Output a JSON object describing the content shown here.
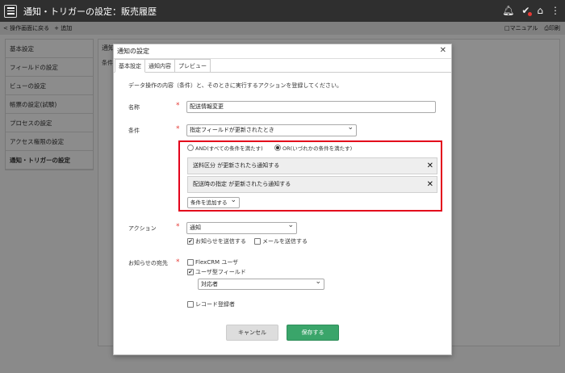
{
  "header": {
    "title": "通知・トリガーの設定：販売履歴",
    "icons": [
      "menu-icon",
      "bell-icon",
      "check-icon",
      "home-icon",
      "more-vert-icon"
    ]
  },
  "toolbar": {
    "back_label": "操作画面に戻る",
    "add_label": "追加",
    "manual_label": "マニュアル",
    "print_label": "印刷"
  },
  "sidebar": {
    "items": [
      {
        "label": "基本設定"
      },
      {
        "label": "フィールドの設定"
      },
      {
        "label": "ビューの設定"
      },
      {
        "label": "帳票の設定(試験)"
      },
      {
        "label": "プロセスの設定"
      },
      {
        "label": "アクセス権限の設定"
      },
      {
        "label": "通知・トリガーの設定"
      }
    ]
  },
  "main": {
    "ghost_title": "通知",
    "ghost_label": "条件"
  },
  "dialog": {
    "title": "通知の設定",
    "tabs": [
      {
        "label": "基本設定"
      },
      {
        "label": "通知内容"
      },
      {
        "label": "プレビュー"
      }
    ],
    "description": "データ操作の内容（条件）と、そのときに実行するアクションを登録してください。",
    "name_label": "名称",
    "name_value": "配送情報変更",
    "condition_label": "条件",
    "condition_value": "指定フィールドが更新されたとき",
    "match_and": "AND(すべての条件を満たす)",
    "match_or": "OR(いづれかの条件を満たす)",
    "conditions": [
      {
        "text": "送料区分 が更新されたら通知する"
      },
      {
        "text": "配送時の指定 が更新されたら通知する"
      }
    ],
    "add_condition": "条件を追加する",
    "action_label": "アクション",
    "action_value": "通知",
    "send_notice": "お知らせを送信する",
    "send_mail": "メールを送信する",
    "recipient_label": "お知らせの宛先",
    "flexcrm_user": "FlexCRM ユーザ",
    "user_field": "ユーザ型フィールド",
    "user_field_value": "対応者",
    "record_creator": "レコード登録者",
    "cancel": "キャンセル",
    "save": "保存する"
  },
  "colors": {
    "accent_green": "#3aa56a",
    "highlight_red": "#e3001b",
    "required_red": "#e53935"
  }
}
